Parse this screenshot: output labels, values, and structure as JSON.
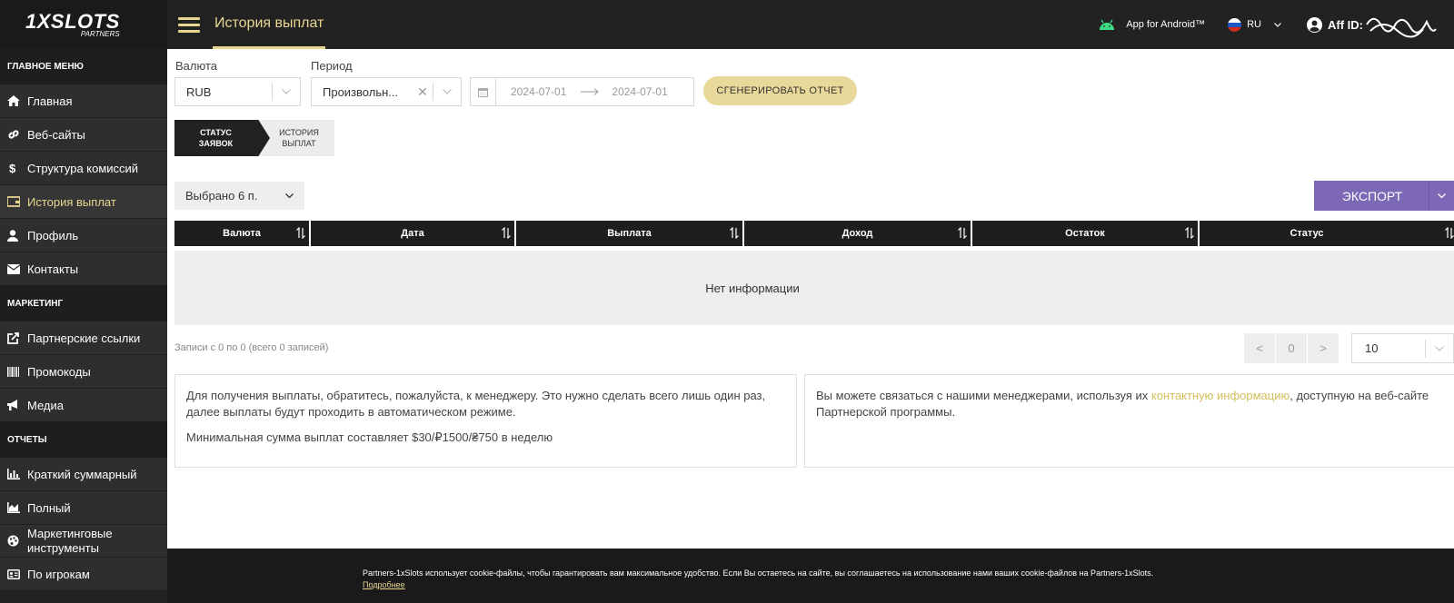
{
  "sidebar": {
    "logo_main": "1XSLOTS",
    "logo_sub": "PARTNERS",
    "sections": [
      {
        "title": "ГЛАВНОЕ МЕНЮ",
        "items": [
          {
            "label": "Главная",
            "icon": "home-icon"
          },
          {
            "label": "Веб-сайты",
            "icon": "link-icon"
          },
          {
            "label": "Структура комиссий",
            "icon": "dollar-icon"
          },
          {
            "label": "История выплат",
            "icon": "wallet-icon",
            "active": true
          },
          {
            "label": "Профиль",
            "icon": "user-icon"
          },
          {
            "label": "Контакты",
            "icon": "envelope-icon"
          }
        ]
      },
      {
        "title": "МАРКЕТИНГ",
        "items": [
          {
            "label": "Партнерские ссылки",
            "icon": "external-link-icon"
          },
          {
            "label": "Промокоды",
            "icon": "barcode-icon"
          },
          {
            "label": "Медиа",
            "icon": "megaphone-icon"
          }
        ]
      },
      {
        "title": "ОТЧЕТЫ",
        "items": [
          {
            "label": "Краткий суммарный",
            "icon": "bar-chart-icon"
          },
          {
            "label": "Полный",
            "icon": "area-chart-icon"
          },
          {
            "label": "Маркетинговые инструменты",
            "icon": "palette-icon"
          },
          {
            "label": "По игрокам",
            "icon": "id-card-icon"
          }
        ]
      }
    ]
  },
  "header": {
    "title": "История выплат",
    "android_label": "App for Android™",
    "language": "RU",
    "aff_label": "Aff ID:"
  },
  "filters": {
    "currency_label": "Валюта",
    "currency_value": "RUB",
    "period_label": "Период",
    "period_value": "Произвольн...",
    "date_from": "2024-07-01",
    "date_to": "2024-07-01",
    "generate_label": "СГЕНЕРИРОВАТЬ ОТЧЕТ"
  },
  "tabs": [
    {
      "label": "СТАТУС ЗАЯВОК",
      "active": true
    },
    {
      "label": "ИСТОРИЯ ВЫПЛАТ",
      "active": false
    }
  ],
  "table": {
    "columns_selected": "Выбрано 6 п.",
    "export_label": "ЭКСПОРТ",
    "headers": [
      "Валюта",
      "Дата",
      "Выплата",
      "Доход",
      "Остаток",
      "Статус"
    ],
    "empty_text": "Нет информации",
    "records_text": "Записи с 0 по 0 (всего 0 записей)",
    "page_current": "0",
    "page_size": "10"
  },
  "info": {
    "left_p1": "Для получения выплаты, обратитесь, пожалуйста, к менеджеру. Это нужно сделать всего лишь один раз, далее выплаты будут проходить в автоматическом режиме.",
    "left_p2": "Минимальная сумма выплат составляет $30/₽1500/₴750 в неделю",
    "right_before": "Вы можете связаться с нашими менеджерами, используя их ",
    "right_link": "контактную информацию",
    "right_after": ", доступную на веб-сайте Партнерской программы."
  },
  "footer": {
    "text": "Partners-1xSlots использует cookie-файлы, чтобы гарантировать вам максимальное удобство. Если Вы остаетесь на сайте, вы соглашаетесь на использование нами ваших cookie-файлов на Partners-1xSlots.",
    "more": "Подробнее"
  },
  "colors": {
    "accent": "#e8d790",
    "export": "#7c68b5",
    "dark": "#222222"
  }
}
